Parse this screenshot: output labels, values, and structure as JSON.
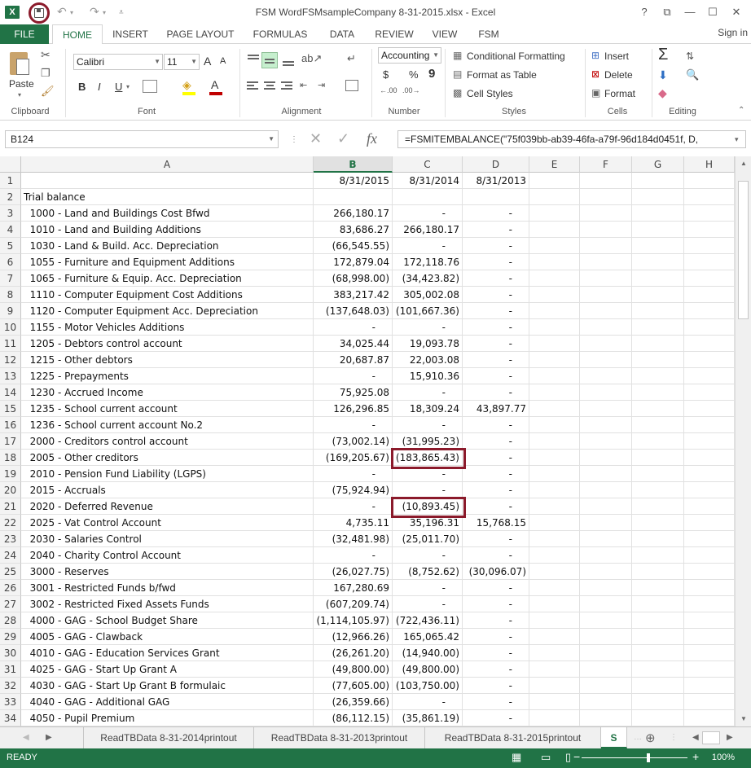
{
  "window": {
    "title": "FSM WordFSMsampleCompany 8-31-2015.xlsx - Excel",
    "app_badge": "X",
    "help": "?",
    "restore": "⧉",
    "minimize": "—",
    "maximize": "☐",
    "close": "✕"
  },
  "ribbon_tabs": [
    "FILE",
    "HOME",
    "INSERT",
    "PAGE LAYOUT",
    "FORMULAS",
    "DATA",
    "REVIEW",
    "VIEW",
    "FSM"
  ],
  "active_tab": "HOME",
  "signin": "Sign in",
  "ribbon": {
    "clipboard": {
      "paste": "Paste",
      "label": "Clipboard"
    },
    "font": {
      "name": "Calibri",
      "size": "11",
      "label": "Font",
      "bold": "B",
      "italic": "I",
      "underline": "U",
      "grow": "A",
      "shrink": "A"
    },
    "alignment": {
      "label": "Alignment"
    },
    "number": {
      "format": "Accounting",
      "currency": "$",
      "percent": "%",
      "comma": "9",
      "label": "Number"
    },
    "styles": {
      "conditional": "Conditional Formatting",
      "table": "Format as Table",
      "cell_styles": "Cell Styles",
      "label": "Styles"
    },
    "cells": {
      "insert": "Insert",
      "delete": "Delete",
      "format": "Format",
      "label": "Cells"
    },
    "editing": {
      "label": "Editing",
      "sum": "Σ"
    }
  },
  "formula_bar": {
    "name_box": "B124",
    "fx": "fx",
    "formula": "=FSMITEMBALANCE(\"75f039bb-ab39-46fa-a79f-96d184d0451f, D,"
  },
  "grid": {
    "columns": [
      "A",
      "B",
      "C",
      "D",
      "E",
      "F",
      "G",
      "H"
    ],
    "selected_column": "B",
    "rows": [
      {
        "n": "1",
        "a": "",
        "b": "8/31/2015",
        "c": "8/31/2014",
        "d": "8/31/2013"
      },
      {
        "n": "2",
        "a": "Trial balance",
        "b": "",
        "c": "",
        "d": ""
      },
      {
        "n": "3",
        "a": "  1000 - Land and Buildings Cost Bfwd",
        "b": "266,180.17",
        "c": "-",
        "d": "-"
      },
      {
        "n": "4",
        "a": "  1010 - Land and Building Additions",
        "b": "83,686.27",
        "c": "266,180.17",
        "d": "-"
      },
      {
        "n": "5",
        "a": "  1030 - Land & Build. Acc. Depreciation",
        "b": "(66,545.55)",
        "c": "-",
        "d": "-"
      },
      {
        "n": "6",
        "a": "  1055 - Furniture and Equipment Additions",
        "b": "172,879.04",
        "c": "172,118.76",
        "d": "-"
      },
      {
        "n": "7",
        "a": "  1065 - Furniture & Equip. Acc. Depreciation",
        "b": "(68,998.00)",
        "c": "(34,423.82)",
        "d": "-"
      },
      {
        "n": "8",
        "a": "  1110 - Computer Equipment Cost Additions",
        "b": "383,217.42",
        "c": "305,002.08",
        "d": "-"
      },
      {
        "n": "9",
        "a": "  1120 - Computer Equipment Acc. Depreciation",
        "b": "(137,648.03)",
        "c": "(101,667.36)",
        "d": "-"
      },
      {
        "n": "10",
        "a": "  1155 - Motor Vehicles Additions",
        "b": "-",
        "c": "-",
        "d": "-"
      },
      {
        "n": "11",
        "a": "  1205 - Debtors control account",
        "b": "34,025.44",
        "c": "19,093.78",
        "d": "-"
      },
      {
        "n": "12",
        "a": "  1215 - Other debtors",
        "b": "20,687.87",
        "c": "22,003.08",
        "d": "-"
      },
      {
        "n": "13",
        "a": "  1225 - Prepayments",
        "b": "-",
        "c": "15,910.36",
        "d": "-"
      },
      {
        "n": "14",
        "a": "  1230 - Accrued Income",
        "b": "75,925.08",
        "c": "-",
        "d": "-"
      },
      {
        "n": "15",
        "a": "  1235 - School current account",
        "b": "126,296.85",
        "c": "18,309.24",
        "d": "43,897.77"
      },
      {
        "n": "16",
        "a": "  1236 - School current account No.2",
        "b": "-",
        "c": "-",
        "d": "-"
      },
      {
        "n": "17",
        "a": "  2000 - Creditors control account",
        "b": "(73,002.14)",
        "c": "(31,995.23)",
        "d": "-"
      },
      {
        "n": "18",
        "a": "  2005 - Other creditors",
        "b": "(169,205.67)",
        "c": "(183,865.43)",
        "d": "-"
      },
      {
        "n": "19",
        "a": "  2010 - Pension Fund Liability (LGPS)",
        "b": "-",
        "c": "-",
        "d": "-"
      },
      {
        "n": "20",
        "a": "  2015 - Accruals",
        "b": "(75,924.94)",
        "c": "-",
        "d": "-"
      },
      {
        "n": "21",
        "a": "  2020 - Deferred Revenue",
        "b": "-",
        "c": "(10,893.45)",
        "d": "-"
      },
      {
        "n": "22",
        "a": "  2025 - Vat Control Account",
        "b": "4,735.11",
        "c": "35,196.31",
        "d": "15,768.15"
      },
      {
        "n": "23",
        "a": "  2030 - Salaries Control",
        "b": "(32,481.98)",
        "c": "(25,011.70)",
        "d": "-"
      },
      {
        "n": "24",
        "a": "  2040 - Charity Control Account",
        "b": "-",
        "c": "-",
        "d": "-"
      },
      {
        "n": "25",
        "a": "  3000 - Reserves",
        "b": "(26,027.75)",
        "c": "(8,752.62)",
        "d": "(30,096.07)"
      },
      {
        "n": "26",
        "a": "  3001 - Restricted Funds b/fwd",
        "b": "167,280.69",
        "c": "-",
        "d": "-"
      },
      {
        "n": "27",
        "a": "  3002 - Restricted Fixed Assets Funds",
        "b": "(607,209.74)",
        "c": "-",
        "d": "-"
      },
      {
        "n": "28",
        "a": "  4000 - GAG - School Budget Share",
        "b": "(1,114,105.97)",
        "c": "(722,436.11)",
        "d": "-"
      },
      {
        "n": "29",
        "a": "  4005 - GAG - Clawback",
        "b": "(12,966.26)",
        "c": "165,065.42",
        "d": "-"
      },
      {
        "n": "30",
        "a": "  4010 - GAG - Education Services Grant",
        "b": "(26,261.20)",
        "c": "(14,940.00)",
        "d": "-"
      },
      {
        "n": "31",
        "a": "  4025 - GAG - Start Up Grant A",
        "b": "(49,800.00)",
        "c": "(49,800.00)",
        "d": "-"
      },
      {
        "n": "32",
        "a": "  4030 - GAG - Start Up Grant B formulaic",
        "b": "(77,605.00)",
        "c": "(103,750.00)",
        "d": "-"
      },
      {
        "n": "33",
        "a": "  4040 - GAG - Additional GAG",
        "b": "(26,359.66)",
        "c": "-",
        "d": "-"
      },
      {
        "n": "34",
        "a": "  4050 - Pupil Premium",
        "b": "(86,112.15)",
        "c": "(35,861.19)",
        "d": "-"
      }
    ]
  },
  "sheet_tabs": [
    "ReadTBData 8-31-2014printout",
    "ReadTBData 8-31-2013printout",
    "ReadTBData 8-31-2015printout",
    "S"
  ],
  "active_sheet": "S",
  "status": {
    "text": "READY",
    "zoom": "100%"
  }
}
